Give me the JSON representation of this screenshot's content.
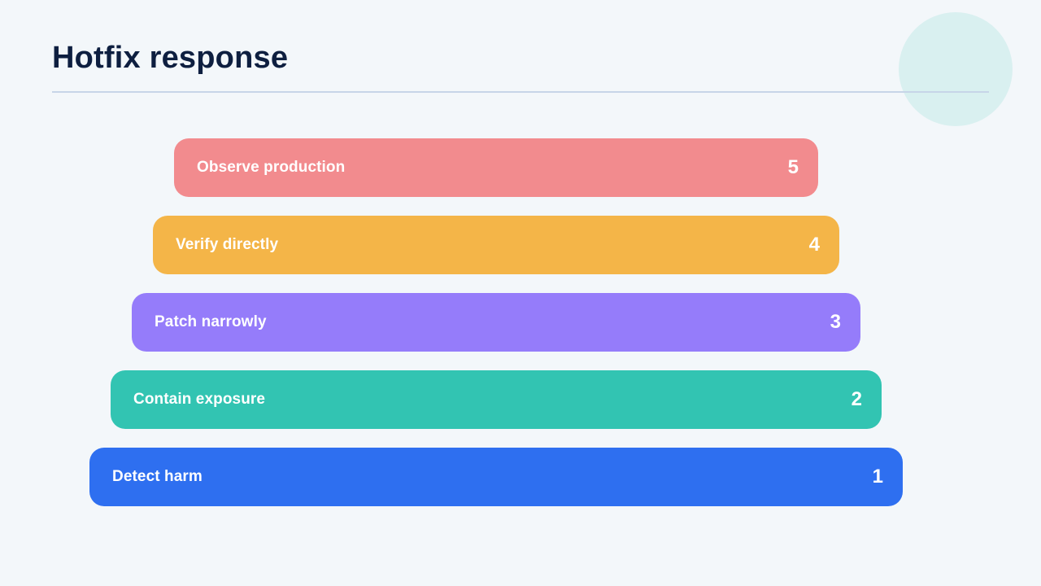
{
  "title": "Hotfix response",
  "tiers": [
    {
      "label": "Observe production",
      "number": "5",
      "color": "#f28b8e"
    },
    {
      "label": "Verify directly",
      "number": "4",
      "color": "#f4b548"
    },
    {
      "label": "Patch narrowly",
      "number": "3",
      "color": "#957cfa"
    },
    {
      "label": "Contain exposure",
      "number": "2",
      "color": "#32c4b2"
    },
    {
      "label": "Detect harm",
      "number": "1",
      "color": "#2e6ff0"
    }
  ]
}
